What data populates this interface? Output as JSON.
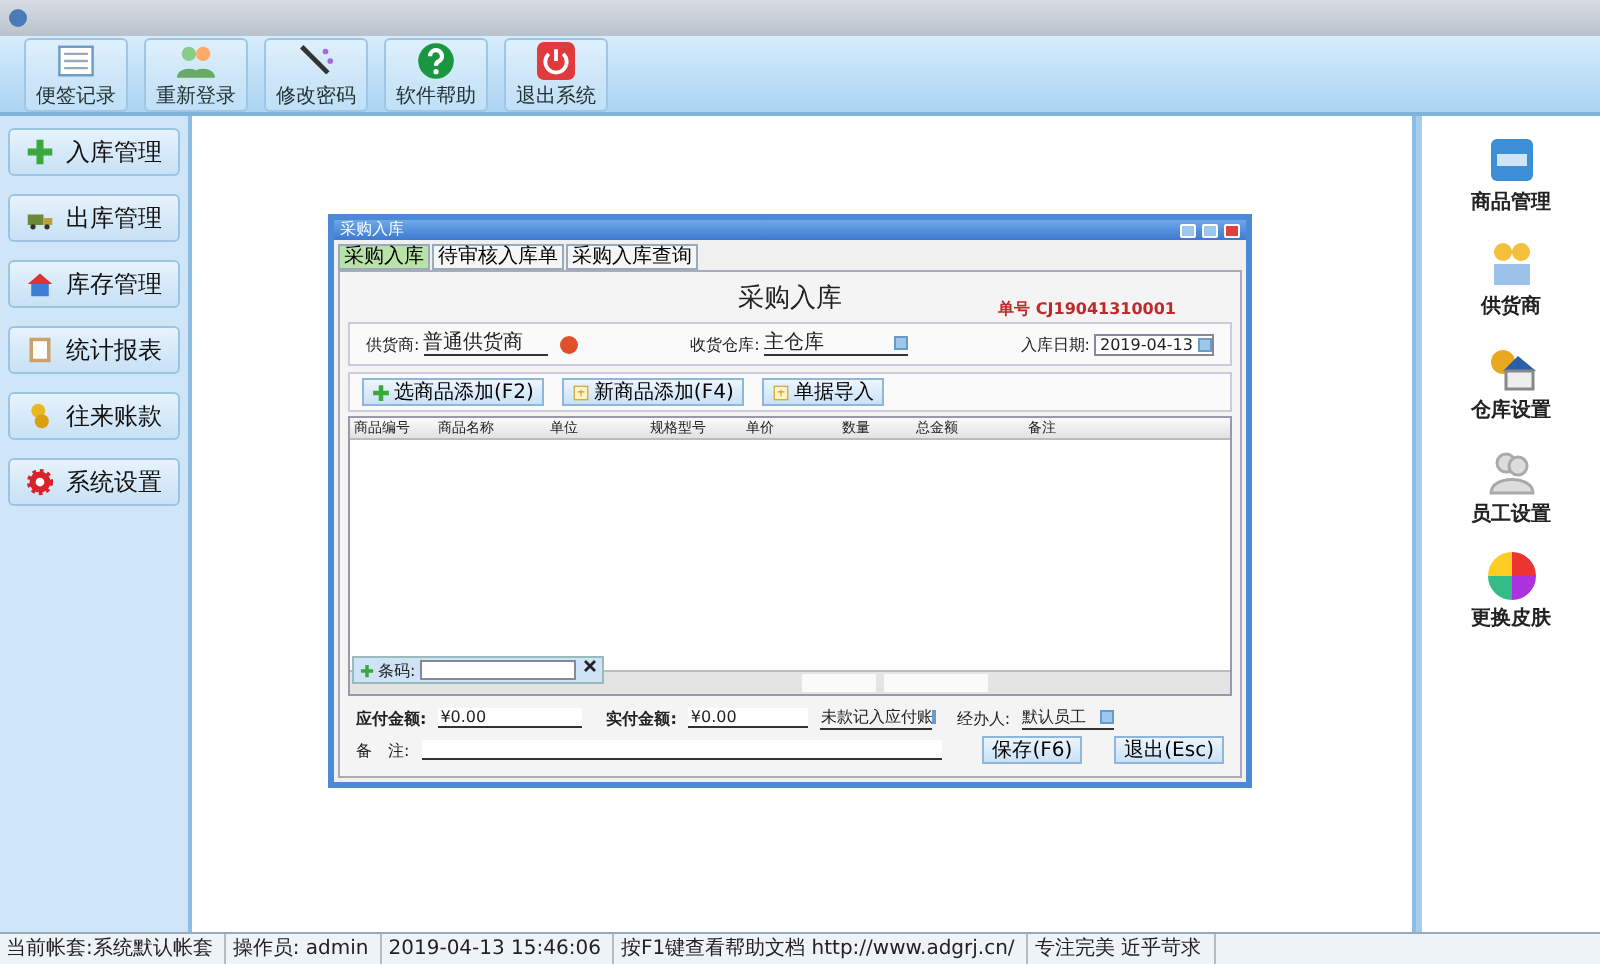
{
  "toolbar": [
    {
      "kind": "notes",
      "label": "便签记录"
    },
    {
      "kind": "users",
      "label": "重新登录"
    },
    {
      "kind": "pen",
      "label": "修改密码"
    },
    {
      "kind": "help",
      "label": "软件帮助"
    },
    {
      "kind": "power",
      "label": "退出系统"
    }
  ],
  "sidebar": {
    "items": [
      {
        "kind": "plus",
        "label": "入库管理"
      },
      {
        "kind": "truck",
        "label": "出库管理"
      },
      {
        "kind": "house",
        "label": "库存管理"
      },
      {
        "kind": "report",
        "label": "统计报表"
      },
      {
        "kind": "coins",
        "label": "往来账款"
      },
      {
        "kind": "gear",
        "label": "系统设置"
      }
    ]
  },
  "dialog": {
    "title": "采购入库",
    "tabs": [
      {
        "label": "采购入库",
        "selected": true
      },
      {
        "label": "待审核入库单",
        "selected": false
      },
      {
        "label": "采购入库查询",
        "selected": false
      }
    ],
    "heading": "采购入库",
    "order_no": "单号 CJ19041310001",
    "supplier": {
      "label": "供货商:",
      "value": "普通供货商"
    },
    "warehouse": {
      "label": "收货仓库:",
      "value": "主仓库"
    },
    "date": {
      "label": "入库日期:",
      "value": "2019-04-13"
    },
    "buttons": [
      {
        "kind": "plus",
        "label": "选商品添加(F2)"
      },
      {
        "kind": "doc",
        "label": "新商品添加(F4)"
      },
      {
        "kind": "doc",
        "label": "单据导入"
      }
    ],
    "table": {
      "columns": [
        "商品编号",
        "商品名称",
        "单位",
        "规格型号",
        "单价",
        "数量",
        "总金额",
        "备注"
      ]
    },
    "barcode": {
      "label": "条码:"
    },
    "payable": {
      "label": "应付金额:",
      "value": "¥0.00"
    },
    "paid": {
      "label": "实付金额:",
      "value": "¥0.00"
    },
    "pay_mode": "未款记入应付账",
    "handler": {
      "label": "经办人:",
      "value": "默认员工"
    },
    "note": {
      "label": "备　注:"
    },
    "actions": [
      "保存(F6)",
      "退出(Esc)"
    ]
  },
  "right_panel": {
    "items": [
      {
        "kind": "goods",
        "label": "商品管理"
      },
      {
        "kind": "supplier",
        "label": "供货商"
      },
      {
        "kind": "warehouse",
        "label": "仓库设置"
      },
      {
        "kind": "staff",
        "label": "员工设置"
      },
      {
        "kind": "skin",
        "label": "更换皮肤"
      }
    ]
  },
  "status_bar": [
    "当前帐套:系统默认帐套",
    "操作员: admin",
    "2019-04-13 15:46:06",
    "按F1键查看帮助文档 http://www.adgrj.cn/",
    "专注完美 近乎苛求"
  ]
}
